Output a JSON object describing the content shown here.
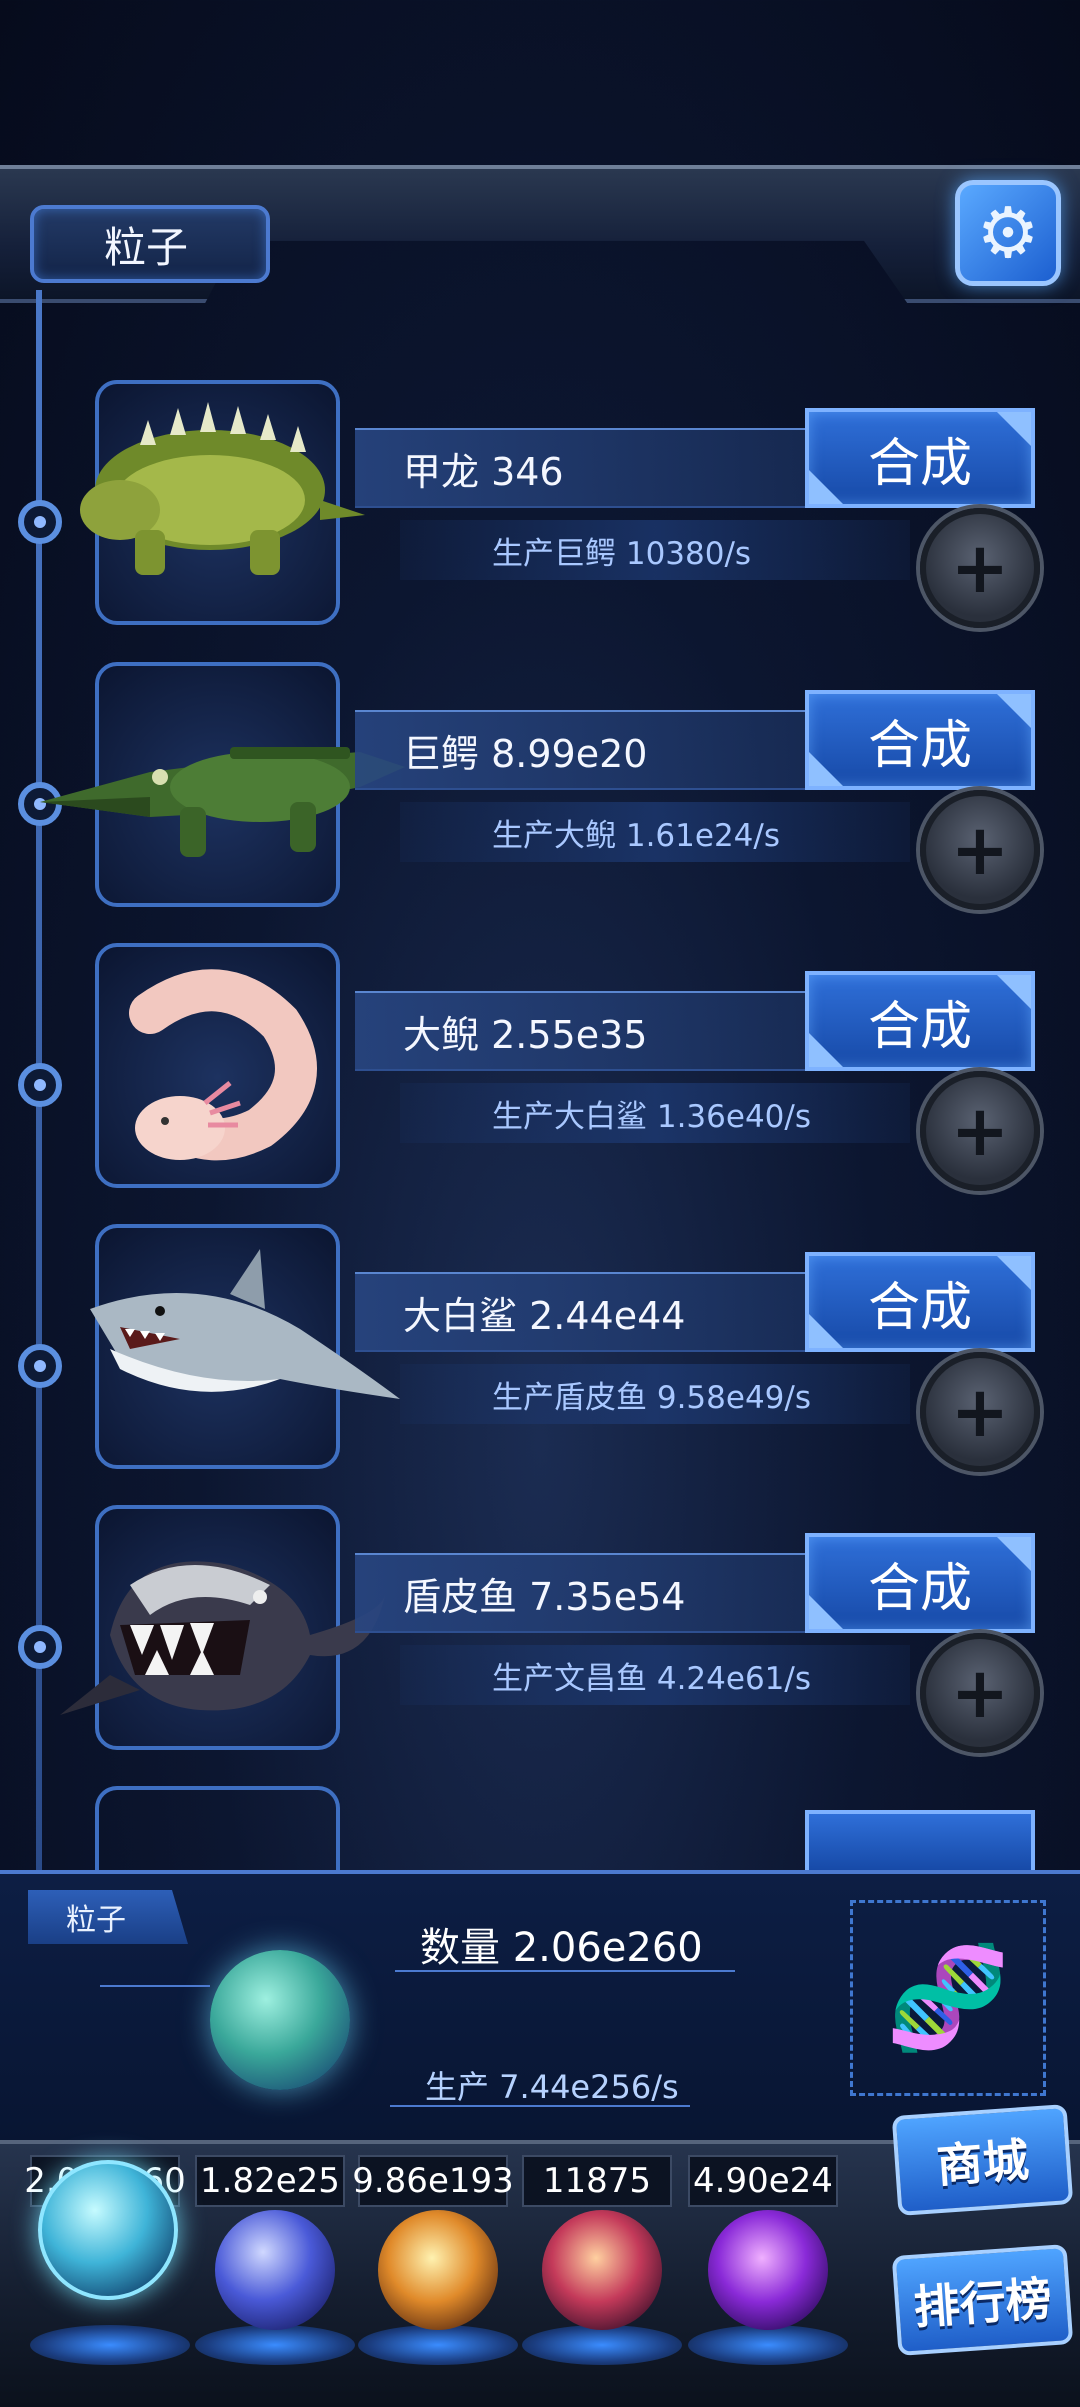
{
  "header": {
    "tab_label": "粒子",
    "settings_icon": "gear-icon"
  },
  "rows": [
    {
      "name": "甲龙 346",
      "production": "生产巨鳄 10380/s",
      "merge_label": "合成",
      "add_icon": "plus-icon",
      "animal_icon": "ankylosaurus-icon"
    },
    {
      "name": "巨鳄 8.99e20",
      "production": "生产大鲵 1.61e24/s",
      "merge_label": "合成",
      "add_icon": "plus-icon",
      "animal_icon": "crocodile-icon"
    },
    {
      "name": "大鲵 2.55e35",
      "production": "生产大白鲨 1.36e40/s",
      "merge_label": "合成",
      "add_icon": "plus-icon",
      "animal_icon": "salamander-icon"
    },
    {
      "name": "大白鲨 2.44e44",
      "production": "生产盾皮鱼 9.58e49/s",
      "merge_label": "合成",
      "add_icon": "plus-icon",
      "animal_icon": "shark-icon"
    },
    {
      "name": "盾皮鱼 7.35e54",
      "production": "生产文昌鱼 4.24e61/s",
      "merge_label": "合成",
      "add_icon": "plus-icon",
      "animal_icon": "armored-fish-icon"
    }
  ],
  "panel": {
    "tab_label": "粒子",
    "count": "数量 2.06e260",
    "rate": "生产 7.44e256/s",
    "dna_icon": "dna-icon"
  },
  "resources": [
    {
      "label": "2.06e260",
      "icon": "particle-orb-icon"
    },
    {
      "label": "1.82e25",
      "icon": "lightning-orb-icon"
    },
    {
      "label": "9.86e193",
      "icon": "fire-orb-icon"
    },
    {
      "label": "11875",
      "icon": "brain-orb-icon"
    },
    {
      "label": "4.90e24",
      "icon": "vortex-orb-icon"
    }
  ],
  "side_buttons": {
    "shop": "商城",
    "leaderboard": "排行榜"
  },
  "colors": {
    "accent": "#2f6fd8",
    "panel": "#0d1e44",
    "background": "#0c1630"
  }
}
